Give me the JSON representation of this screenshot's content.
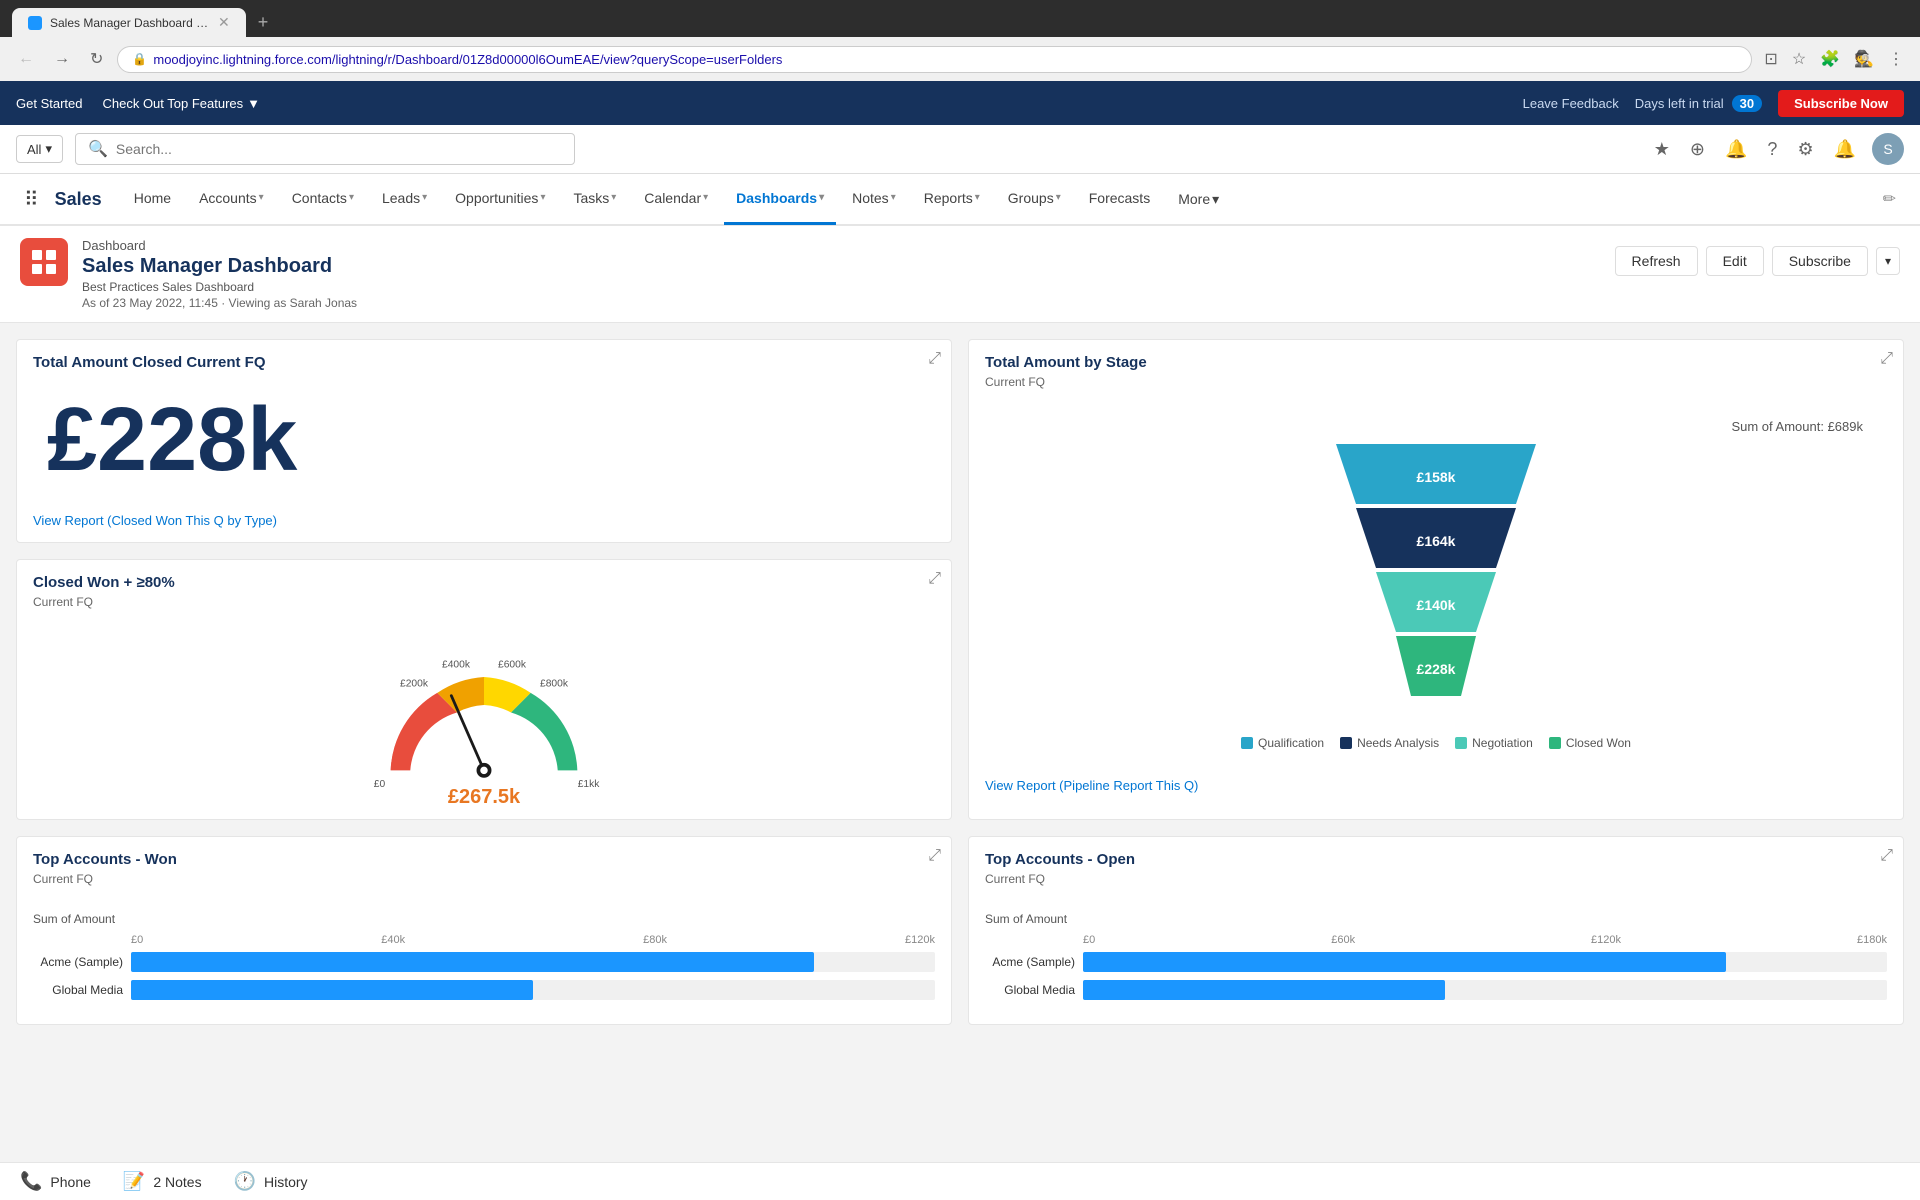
{
  "browser": {
    "tab_title": "Sales Manager Dashboard | Sa...",
    "url": "moodjoyinc.lightning.force.com/lightning/r/Dashboard/01Z8d00000l6OumEAE/view?queryScope=userFolders",
    "favicon_label": "S"
  },
  "topbar": {
    "get_started": "Get Started",
    "top_features": "Check Out Top Features",
    "leave_feedback": "Leave Feedback",
    "days_left_label": "Days left in trial",
    "trial_days": "30",
    "subscribe_label": "Subscribe Now"
  },
  "search": {
    "scope": "All",
    "placeholder": "Search..."
  },
  "navbar": {
    "app_name": "Sales",
    "items": [
      {
        "label": "Home",
        "active": false
      },
      {
        "label": "Accounts",
        "active": false,
        "has_chevron": true
      },
      {
        "label": "Contacts",
        "active": false,
        "has_chevron": true
      },
      {
        "label": "Leads",
        "active": false,
        "has_chevron": true
      },
      {
        "label": "Opportunities",
        "active": false,
        "has_chevron": true
      },
      {
        "label": "Tasks",
        "active": false,
        "has_chevron": true
      },
      {
        "label": "Calendar",
        "active": false,
        "has_chevron": true
      },
      {
        "label": "Dashboards",
        "active": true,
        "has_chevron": true
      },
      {
        "label": "Notes",
        "active": false,
        "has_chevron": true
      },
      {
        "label": "Reports",
        "active": false,
        "has_chevron": true
      },
      {
        "label": "Groups",
        "active": false,
        "has_chevron": true
      },
      {
        "label": "Forecasts",
        "active": false
      },
      {
        "label": "More",
        "has_chevron": true
      }
    ]
  },
  "dashboard": {
    "breadcrumb": "Dashboard",
    "title": "Sales Manager Dashboard",
    "subtitle": "Best Practices Sales Dashboard",
    "meta": "As of 23 May 2022, 11:45 · Viewing as Sarah Jonas",
    "actions": {
      "refresh": "Refresh",
      "edit": "Edit",
      "subscribe": "Subscribe"
    }
  },
  "widget_total_amount": {
    "title": "Total Amount Closed Current FQ",
    "value": "£228k",
    "link": "View Report (Closed Won This Q by Type)"
  },
  "widget_closed_won": {
    "title": "Closed Won + ≥80%",
    "subtitle": "Current FQ",
    "value": "£267.5k",
    "gauge_labels": [
      "£0",
      "£200k",
      "£400k",
      "£600k",
      "£800k",
      "£1kk"
    ]
  },
  "widget_funnel": {
    "title": "Total Amount by Stage",
    "subtitle": "Current FQ",
    "sum_label": "Sum of Amount: £689k",
    "segments": [
      {
        "label": "£158k",
        "color": "#29a5c9",
        "width_pct": 70
      },
      {
        "label": "£164k",
        "color": "#16325c",
        "width_pct": 60
      },
      {
        "label": "£140k",
        "color": "#4bc9b7",
        "width_pct": 50
      },
      {
        "label": "£228k",
        "color": "#2eb67d",
        "width_pct": 38
      }
    ],
    "legend": [
      {
        "label": "Qualification",
        "color": "#29a5c9"
      },
      {
        "label": "Needs Analysis",
        "color": "#16325c"
      },
      {
        "label": "Negotiation",
        "color": "#4bc9b7"
      },
      {
        "label": "Closed Won",
        "color": "#2eb67d"
      }
    ],
    "link": "View Report (Pipeline Report This Q)"
  },
  "widget_top_accounts_won": {
    "title": "Top Accounts - Won",
    "subtitle": "Current FQ",
    "axis_label": "Sum of Amount",
    "axis_ticks": [
      "£0",
      "£40k",
      "£80k",
      "£120k"
    ],
    "bars": [
      {
        "label": "Acme (Sample)",
        "pct": 85
      },
      {
        "label": "Global Media",
        "pct": 50
      }
    ]
  },
  "widget_top_accounts_open": {
    "title": "Top Accounts - Open",
    "subtitle": "Current FQ",
    "axis_label": "Sum of Amount",
    "axis_ticks": [
      "£0",
      "£60k",
      "£120k",
      "£180k"
    ],
    "bars": [
      {
        "label": "Acme (Sample)",
        "pct": 80
      },
      {
        "label": "Global Media",
        "pct": 45
      }
    ]
  },
  "statusbar": {
    "phone": "Phone",
    "notes": "2 Notes",
    "history": "History"
  }
}
